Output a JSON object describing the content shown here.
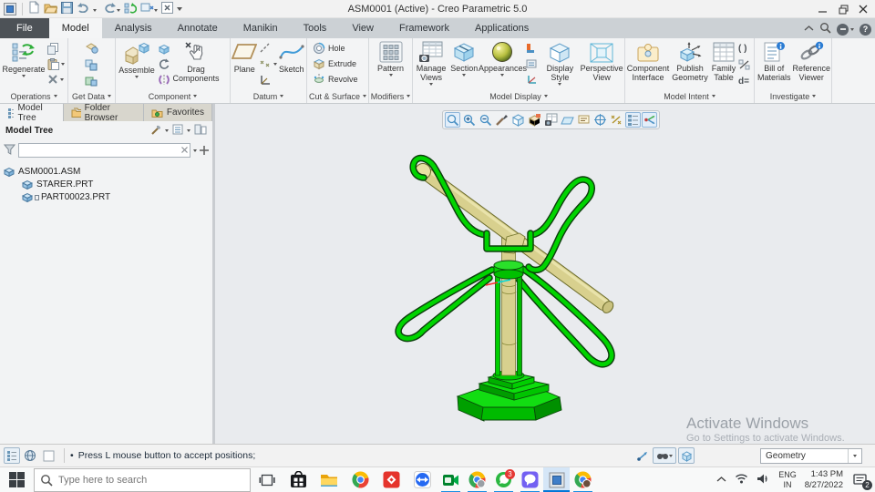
{
  "titlebar": {
    "title": "ASM0001 (Active) - Creo Parametric 5.0"
  },
  "tabs": {
    "file": "File",
    "items": [
      "Model",
      "Analysis",
      "Annotate",
      "Manikin",
      "Tools",
      "View",
      "Framework",
      "Applications"
    ],
    "active": "Model"
  },
  "ribbon": {
    "groups": {
      "operations": "Operations",
      "get_data": "Get Data",
      "component": "Component",
      "datum": "Datum",
      "cut_surface": "Cut & Surface",
      "modifiers": "Modifiers",
      "model_display": "Model Display",
      "model_intent": "Model Intent",
      "investigate": "Investigate"
    },
    "buttons": {
      "regenerate": "Regenerate",
      "assemble": "Assemble",
      "drag_components": "Drag Components",
      "plane": "Plane",
      "sketch": "Sketch",
      "hole": "Hole",
      "extrude": "Extrude",
      "revolve": "Revolve",
      "pattern": "Pattern",
      "manage_views": "Manage Views",
      "section": "Section",
      "appearances": "Appearances",
      "display_style": "Display Style",
      "perspective_view": "Perspective View",
      "component_interface": "Component Interface",
      "publish_geometry": "Publish Geometry",
      "family_table": "Family Table",
      "parens": "( )",
      "d_equals": "d=",
      "bill_of_materials": "Bill of Materials",
      "reference_viewer": "Reference Viewer"
    }
  },
  "nav_panel": {
    "tabs": [
      "Model Tree",
      "Folder Browser",
      "Favorites"
    ],
    "header": "Model Tree",
    "tree": [
      "ASM0001.ASM",
      "STARER.PRT",
      "PART00023.PRT"
    ]
  },
  "viewport": {
    "watermark_title": "Activate Windows",
    "watermark_sub": "Go to Settings to activate Windows."
  },
  "status_bar": {
    "bullet": "•",
    "message": "Press L mouse button to accept positions;",
    "filter_value": "Geometry"
  },
  "taskbar": {
    "search_placeholder": "Type here to search",
    "badges": {
      "whatsapp": "3"
    },
    "tray": {
      "lang_top": "ENG",
      "lang_bottom": "IN",
      "time": "1:43 PM",
      "date": "8/27/2022",
      "notification_count": "2"
    }
  },
  "icons": {
    "help_glyph": "?"
  }
}
